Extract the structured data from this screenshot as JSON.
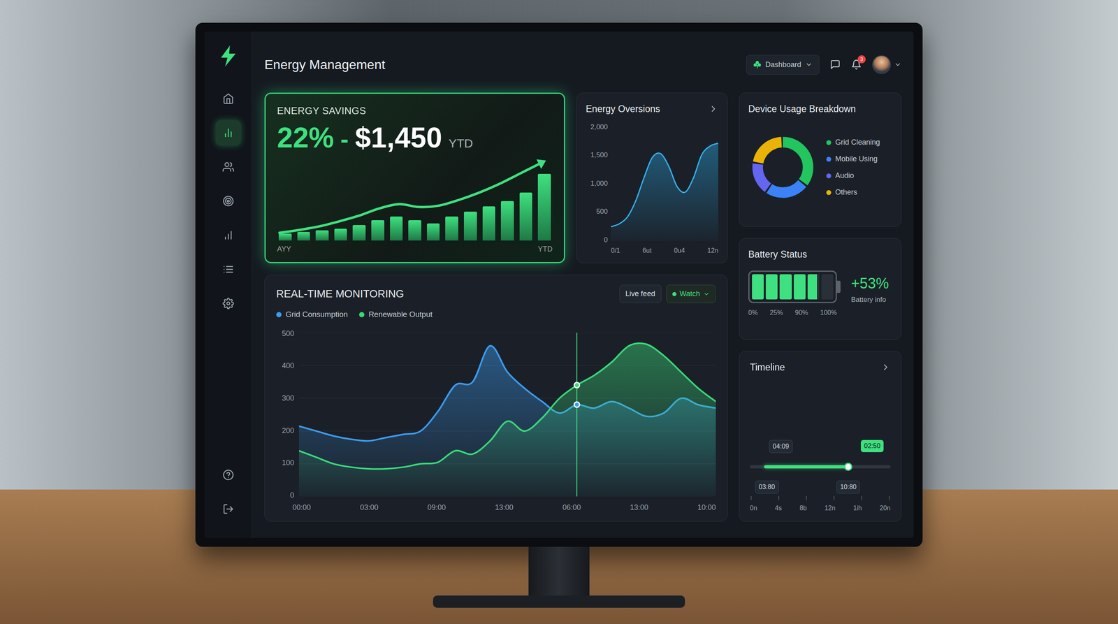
{
  "app": {
    "title": "Energy Management"
  },
  "sidebar": {
    "items": [
      {
        "selected": false
      },
      {
        "selected": true
      },
      {
        "selected": false
      },
      {
        "selected": false
      },
      {
        "selected": false
      },
      {
        "selected": false
      },
      {
        "selected": false
      }
    ]
  },
  "header": {
    "dropdown": "Dashboard",
    "notifications": "3"
  },
  "savings": {
    "title": "ENERGY SAVINGS",
    "percent": "22%",
    "separator": "-",
    "amount": "$1,450",
    "period": "YTD",
    "axis_start": "AYY",
    "axis_end": "YTD",
    "bars": [
      8,
      10,
      12,
      14,
      18,
      24,
      28,
      24,
      20,
      28,
      34,
      40,
      46,
      56,
      78
    ],
    "trend": [
      4,
      8,
      13,
      20,
      28,
      38,
      44,
      40,
      42,
      50,
      60,
      72,
      86,
      100
    ]
  },
  "oversions": {
    "title": "Energy Oversions",
    "y_ticks": [
      "2,000",
      "1,500",
      "1,000",
      "500",
      "0"
    ],
    "x_ticks": [
      "0/1",
      "6ut",
      "0u4",
      "12n"
    ],
    "values": [
      250,
      300,
      420,
      700,
      1100,
      1450,
      1520,
      1300,
      950,
      850,
      1100,
      1500,
      1650,
      1700
    ]
  },
  "device_usage": {
    "title": "Device Usage Breakdown",
    "items": [
      {
        "label": "Grid Cleaning",
        "share": 0.36,
        "color": "#22c55e"
      },
      {
        "label": "Mobile Using",
        "share": 0.24,
        "color": "#3b82f6"
      },
      {
        "label": "Audio",
        "share": 0.18,
        "color": "#6366f1"
      },
      {
        "label": "Others",
        "share": 0.22,
        "color": "#eab308"
      }
    ]
  },
  "battery": {
    "title": "Battery Status",
    "level": 0.8,
    "reading": "+53%",
    "caption": "Battery info",
    "ticks": [
      "0%",
      "25%",
      "90%",
      "100%"
    ]
  },
  "timeline": {
    "title": "Timeline",
    "range_start": 0.1,
    "level": 0.7,
    "labels": [
      {
        "text": "04:09",
        "at": 0.22,
        "side": "top",
        "highlight": false
      },
      {
        "text": "03:80",
        "at": 0.12,
        "side": "bottom",
        "highlight": false
      },
      {
        "text": "10:80",
        "at": 0.7,
        "side": "bottom",
        "highlight": false
      },
      {
        "text": "02:50",
        "at": 0.87,
        "side": "top",
        "highlight": true
      }
    ],
    "x_ticks": [
      "0n",
      "4s",
      "8b",
      "12n",
      "1ih",
      "20n"
    ]
  },
  "monitoring": {
    "title": "REAL-TIME MONITORING",
    "buttons": [
      {
        "label": "Live feed",
        "kind": "plain"
      },
      {
        "label": "Watch",
        "kind": "dropdown"
      }
    ],
    "series": [
      {
        "label": "Grid Consumption",
        "color": "#3b9cf0",
        "values": [
          215,
          200,
          185,
          175,
          170,
          180,
          190,
          200,
          260,
          340,
          350,
          460,
          380,
          330,
          290,
          255,
          280,
          270,
          290,
          270,
          245,
          255,
          300,
          280,
          270
        ]
      },
      {
        "label": "Renewable Output",
        "color": "#39d97a",
        "values": [
          140,
          120,
          100,
          90,
          85,
          85,
          90,
          100,
          105,
          140,
          130,
          170,
          230,
          200,
          240,
          300,
          340,
          370,
          410,
          460,
          465,
          430,
          380,
          330,
          290
        ]
      }
    ],
    "y_ticks": [
      "500",
      "400",
      "300",
      "200",
      "100",
      "0"
    ],
    "x_ticks": [
      "00:00",
      "03:00",
      "09:00",
      "13:00",
      "06:00",
      "13:00",
      "10:00"
    ],
    "cursor_index": 16
  }
}
